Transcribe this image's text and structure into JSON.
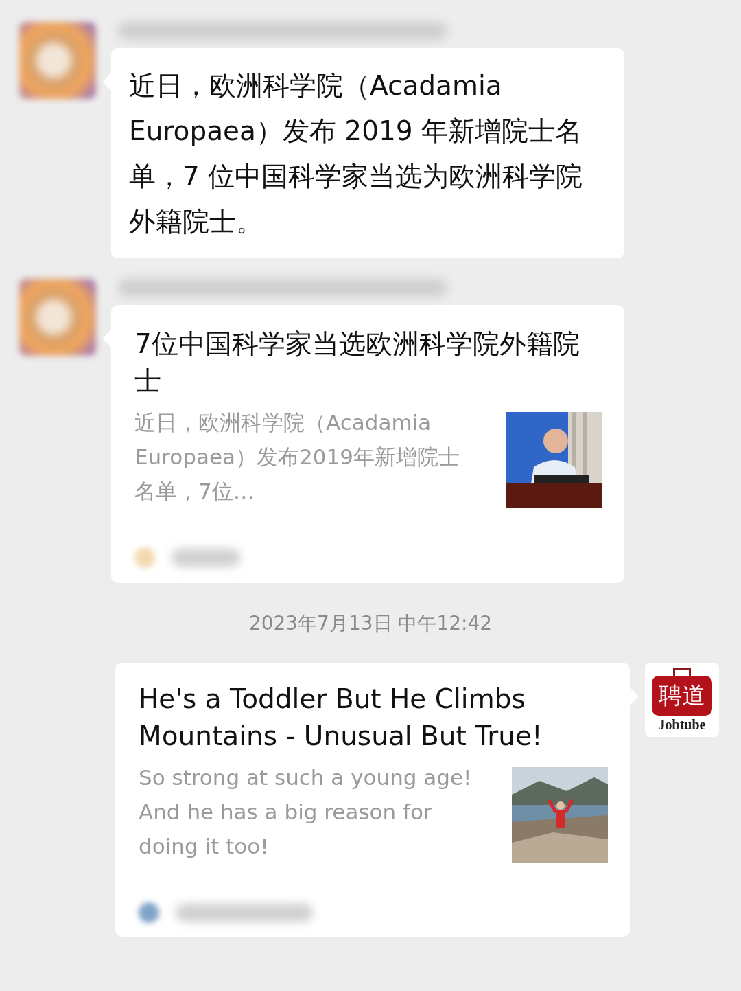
{
  "messages": [
    {
      "kind": "incoming_text",
      "text": "近日，欧洲科学院（Acadamia Europaea）发布 2019 年新增院士名单，7 位中国科学家当选为欧洲科学院外籍院士。"
    },
    {
      "kind": "incoming_article",
      "title": "7位中国科学家当选欧洲科学院外籍院士",
      "description": "近日，欧洲科学院（Acadamia Europaea）发布2019年新增院士名单，7位…"
    },
    {
      "kind": "timestamp",
      "text": "2023年7月13日 中午12:42"
    },
    {
      "kind": "outgoing_article",
      "avatar": {
        "logo": "聘道",
        "caption": "Jobtube"
      },
      "title": "He's a Toddler But He Climbs Mountains - Unusual But True!",
      "description": "So strong at such a young age! And he has a big reason for doing it too!"
    }
  ]
}
